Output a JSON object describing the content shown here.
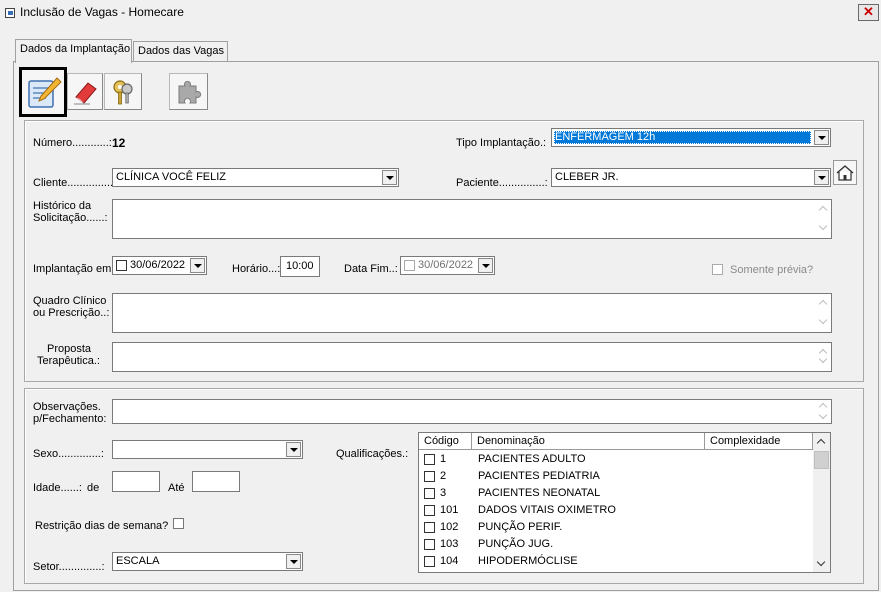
{
  "window": {
    "title": "Inclusão de Vagas - Homecare",
    "close_glyph": "✕"
  },
  "tabs": [
    "Dados da Implantação",
    "Dados das Vagas"
  ],
  "toolbar": {
    "icons": [
      "notepad-edit-icon",
      "eraser-icon",
      "keys-icon",
      "puzzle-icon"
    ]
  },
  "form": {
    "numero_label": "Número............:",
    "numero_value": "12",
    "tipo_label": "Tipo Implantação.:",
    "tipo_value": "ENFERMAGEM 12h",
    "cliente_label": "Cliente...............:",
    "cliente_value": "CLÍNICA VOCÊ FELIZ",
    "paciente_label": "Paciente...............:",
    "paciente_value": "CLEBER JR.",
    "historico_label_1": "Histórico da",
    "historico_label_2": "Solicitação......:",
    "implantacao_label": "Implantação em:",
    "implantacao_value": "30/06/2022",
    "horario_label": "Horário...:",
    "horario_value": "10:00",
    "datafim_label": "Data Fim..:",
    "datafim_value": "30/06/2022",
    "somente_previa_label": "Somente prévia?",
    "quadro_label_1": "Quadro Clínico",
    "quadro_label_2": "ou Prescrição..:",
    "proposta_label_1": "Proposta",
    "proposta_label_2": "Terapêutica.:",
    "obs_label_1": "Observações.",
    "obs_label_2": "p/Fechamento:",
    "sexo_label": "Sexo..............:",
    "sexo_value": "",
    "qualificacoes_label": "Qualificações.:",
    "idade_label": "Idade......:",
    "idade_de_label": "de",
    "idade_ate_label": "Até",
    "idade_de_value": "",
    "idade_ate_value": "",
    "restricao_label": "Restrição dias de semana?",
    "setor_label": "Setor..............:",
    "setor_value": "ESCALA"
  },
  "qualificacoes": {
    "columns": [
      "Código",
      "Denominação",
      "Complexidade"
    ],
    "rows": [
      {
        "code": "1",
        "name": "PACIENTES ADULTO"
      },
      {
        "code": "2",
        "name": "PACIENTES PEDIATRIA"
      },
      {
        "code": "3",
        "name": "PACIENTES NEONATAL"
      },
      {
        "code": "101",
        "name": "DADOS VITAIS OXIMETRO"
      },
      {
        "code": "102",
        "name": "PUNÇÃO PERIF."
      },
      {
        "code": "103",
        "name": "PUNÇÃO JUG."
      },
      {
        "code": "104",
        "name": "HIPODERMÓCLISE"
      }
    ]
  },
  "colors": {
    "selection": "#0078d7",
    "window_bg": "#f0f0f0"
  }
}
